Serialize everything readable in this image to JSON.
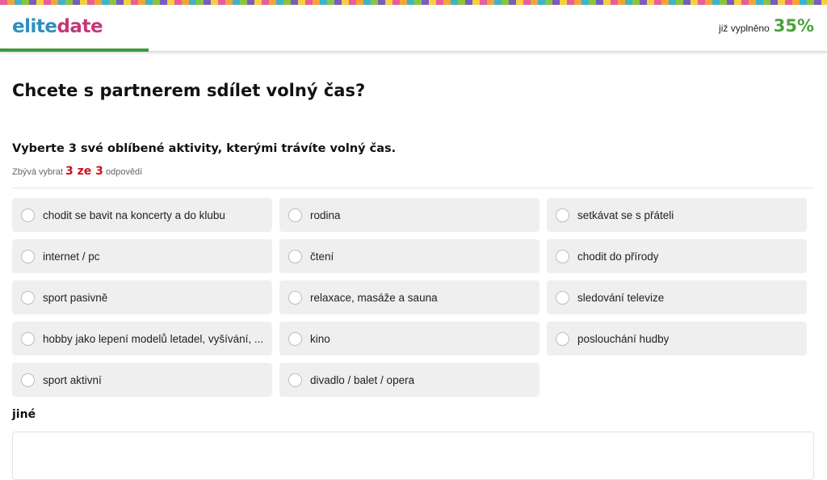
{
  "header": {
    "logo_part1": "elite",
    "logo_part2": "date",
    "progress_label": "již vyplněno",
    "progress_value": "35%",
    "progress_fraction": 0.35
  },
  "question": {
    "title": "Chcete s partnerem sdílet volný čas?",
    "subtitle": "Vyberte 3 své oblíbené aktivity, kterými trávíte volný čas.",
    "remaining_prefix": "Zbývá vybrat",
    "remaining_count": "3 ze 3",
    "remaining_suffix": "odpovědí"
  },
  "options": [
    "chodit se bavit na koncerty a do klubu",
    "rodina",
    "setkávat se s přáteli",
    "internet / pc",
    "čtení",
    "chodit do přírody",
    "sport pasivně",
    "relaxace, masáže a sauna",
    "sledování televize",
    "hobby jako lepení modelů letadel, vyšívání, ...",
    "kino",
    "poslouchání hudby",
    "sport aktivní",
    "divadlo / balet / opera"
  ],
  "other": {
    "label": "jiné",
    "value": ""
  },
  "colors": {
    "logo_blue": "#2e8fbf",
    "logo_magenta": "#c23a7a",
    "progress_green": "#4aa23c",
    "counter_red": "#d0101a",
    "option_bg": "#efefef"
  }
}
